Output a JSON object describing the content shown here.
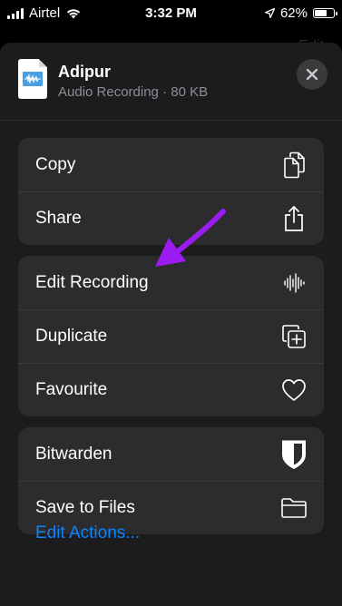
{
  "status_bar": {
    "carrier": "Airtel",
    "time": "3:32 PM",
    "battery": "62%"
  },
  "background": {
    "right_label": "Edit"
  },
  "header": {
    "title": "Adipur",
    "subtitle": "Audio Recording · 80 KB",
    "close_icon": "close-icon"
  },
  "groups": [
    {
      "items": [
        {
          "label": "Copy",
          "icon": "copy-icon"
        },
        {
          "label": "Share",
          "icon": "share-icon"
        }
      ]
    },
    {
      "items": [
        {
          "label": "Edit Recording",
          "icon": "waveform-icon"
        },
        {
          "label": "Duplicate",
          "icon": "duplicate-icon"
        },
        {
          "label": "Favourite",
          "icon": "heart-icon"
        }
      ]
    },
    {
      "items": [
        {
          "label": "Bitwarden",
          "icon": "shield-icon"
        },
        {
          "label": "Save to Files",
          "icon": "folder-icon"
        }
      ]
    }
  ],
  "edit_actions": "Edit Actions...",
  "colors": {
    "sheet_bg": "#1c1c1e",
    "group_bg": "#2c2c2e",
    "accent": "#0a84ff",
    "annotation_arrow": "#9b1cf0"
  }
}
